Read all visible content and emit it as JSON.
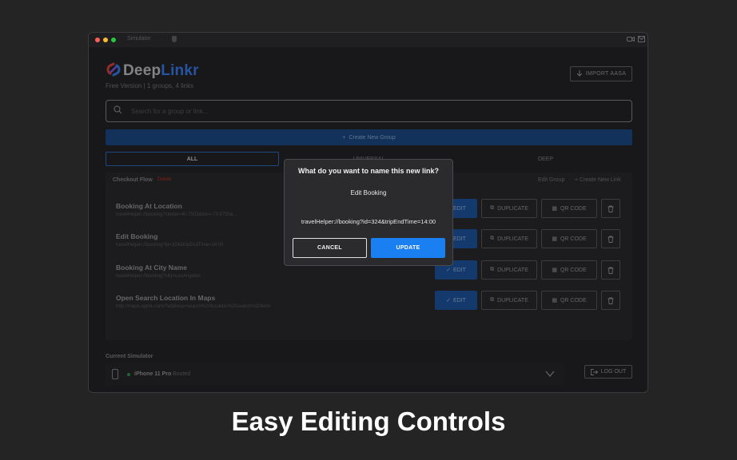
{
  "window": {
    "titlebar_label": "Simulator",
    "traffic_light_colors": [
      "#ff5f57",
      "#febc2e",
      "#28c840"
    ]
  },
  "app": {
    "logo_prefix": "Deep",
    "logo_suffix": "Linkr",
    "subtitle": "Free Version | 1 groups, 4 links",
    "import_label": "IMPORT AASA",
    "search_placeholder": "Search for a group or link...",
    "create_group_label": "Create New Group",
    "tabs": [
      {
        "label": "ALL",
        "active": true
      },
      {
        "label": "UNIVERSAL",
        "active": false
      },
      {
        "label": "DEEP",
        "active": false
      }
    ],
    "group": {
      "title": "Checkout Flow",
      "badge": "Delete",
      "edit_label": "Edit Group",
      "new_link_label": "+ Create New Link",
      "links": [
        {
          "title": "Booking At Location",
          "url": "travelHelper://booking?center=40.7503&lon=-73.9755&..."
        },
        {
          "title": "Edit Booking",
          "url": "travelHelper://booking?id=324&tripEndTime=14:00"
        },
        {
          "title": "Booking At City Name",
          "url": "travelHelper://booking?city=LosAngeles"
        },
        {
          "title": "Open Search Location In Maps",
          "url": "http://maps.apple.com/?address=search%20location%20search%20term"
        }
      ],
      "edit_label_btn": "EDIT",
      "duplicate_label": "DUPLICATE",
      "qr_label": "QR CODE"
    },
    "simulator": {
      "section_label": "Current Simulator",
      "device": "iPhone 11 Pro",
      "state": "Booted",
      "status_color": "#2ea043"
    },
    "logout_label": "LOG OUT",
    "accent_color": "#1a7ff0"
  },
  "modal": {
    "title": "What do you want to name this new link?",
    "name_value": "Edit Booking",
    "url_value": "travelHelper://booking?id=324&tripEndTime=14:00",
    "cancel_label": "CANCEL",
    "update_label": "UPDATE"
  },
  "caption": "Easy Editing Controls"
}
